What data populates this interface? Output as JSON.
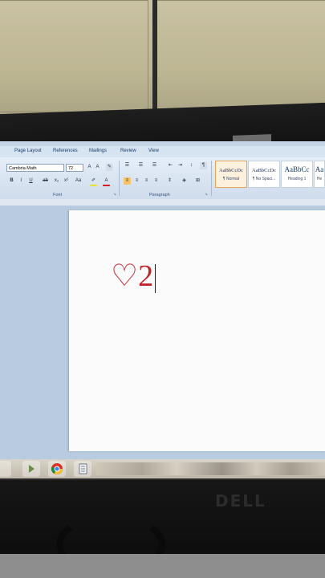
{
  "ribbon": {
    "tabs": [
      "Page Layout",
      "References",
      "Mailings",
      "Review",
      "View"
    ],
    "font_name": "Cambria Math",
    "font_size": "72",
    "group_font": "Font",
    "group_paragraph": "Paragraph",
    "styles": [
      {
        "preview": "AaBbCcDc",
        "name": "¶ Normal"
      },
      {
        "preview": "AaBbCcDc",
        "name": "¶ No Spaci..."
      },
      {
        "preview": "AaBbCc",
        "name": "Heading 1"
      },
      {
        "preview": "Aa",
        "name": "He"
      }
    ]
  },
  "document": {
    "text": "♡2"
  },
  "colors": {
    "text_color": "#c0242c",
    "ribbon_bg": "#dce6f2"
  }
}
